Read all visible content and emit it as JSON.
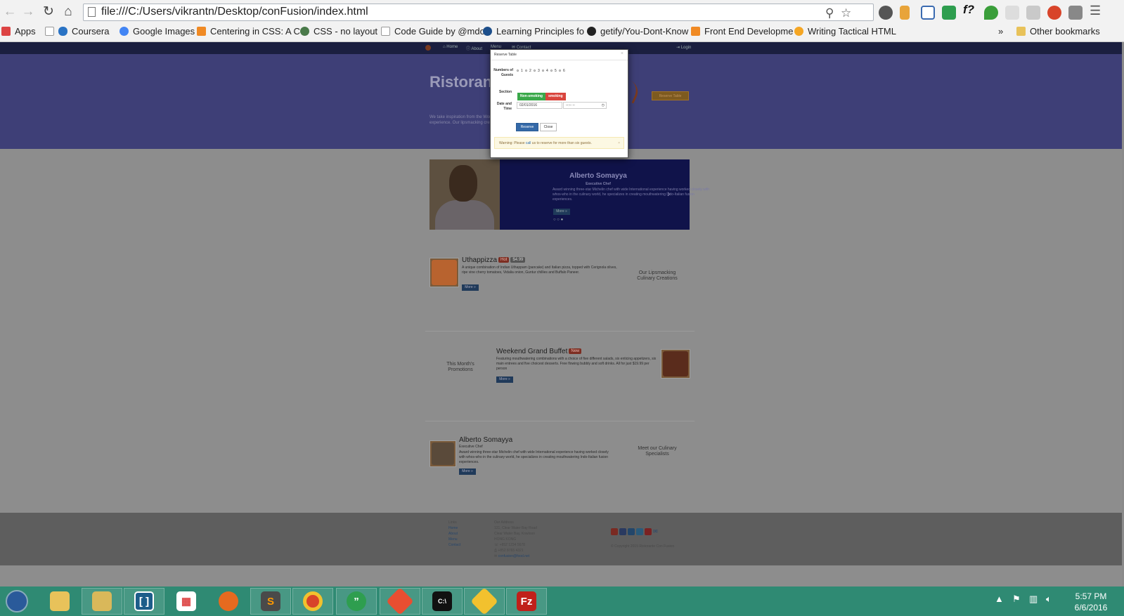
{
  "browser": {
    "url": "file:///C:/Users/vikrantn/Desktop/conFusion/index.html",
    "bookmarks": [
      "Apps",
      "Coursera",
      "Google Images",
      "Centering in CSS: A C",
      "CSS - no layout",
      "Code Guide by @mdo",
      "Learning Principles fo",
      "getify/You-Dont-Know",
      "Front End Developme",
      "Writing Tactical HTML"
    ],
    "bookmarks_overflow": "»",
    "other_bookmarks": "Other bookmarks"
  },
  "site": {
    "nav": [
      "Home",
      "About",
      "Menu",
      "Contact"
    ],
    "login": "Login",
    "brand_title": "Ristorante",
    "jumbo_text_1": "We take inspiration from the World's best cuisines, and create a unique fusion",
    "jumbo_text_2": "experience. Our lipsmacking creations will tickle your culinary senses!",
    "reserve_top": "Reserve Table",
    "carousel": {
      "name": "Alberto Somayya",
      "designation": "Executive Chef",
      "description": "Award winning three-star Michelin chef with wide International experience having worked closely with whos-who in the culinary world, he specializes in creating mouthwatering Indo-Italian fusion experiences.",
      "more": "More »",
      "dots": "○ ○ ●",
      "next": "›"
    },
    "dish": {
      "name": "Uthappizza",
      "label": "Hot",
      "price": "$4.99",
      "description": "A unique combination of Indian Uthappam (pancake) and Italian pizza, topped with Cerignola olives, ripe vine cherry tomatoes, Vidalia onion, Guntur chillies and Buffalo Paneer.",
      "more": "More »",
      "side": "Our Lipsmacking Culinary Creations"
    },
    "promo": {
      "name": "Weekend Grand Buffet",
      "label": "New",
      "description": "Featuring mouthwatering combinations with a choice of five different salads, six enticing appetizers, six main entrees and five choicest desserts. Free flowing bubbly and soft drinks. All for just $19.99 per person",
      "more": "More »",
      "side": "This Month's Promotions"
    },
    "leader": {
      "name": "Alberto Somayya",
      "designation": "Executive Chef",
      "description": "Award winning three-star Michelin chef with wide International experience having worked closely with whos-who in the culinary world, he specializes in creating mouthwatering Indo-Italian fusion experiences.",
      "more": "More »",
      "side": "Meet our Culinary Specialists"
    },
    "footer": {
      "links_title": "Links",
      "links": [
        "Home",
        "About",
        "Menu",
        "Contact"
      ],
      "address_title": "Our Address",
      "address_lines": [
        "121, Clear Water Bay Road",
        "Clear Water Bay, Kowloon",
        "HONG KONG",
        "+852 1234 5678",
        "+852 8765 4321",
        "confusion@food.net"
      ],
      "copyright": "© Copyright 2015 Ristorante Con Fusion"
    }
  },
  "modal": {
    "title": "Reserve Table",
    "close": "×",
    "guests_label": "Numbers of Guests",
    "guest_options": [
      "1",
      "2",
      "3",
      "4",
      "5",
      "6"
    ],
    "section_label": "Section",
    "section_nonsmoking": "Non-smoking",
    "section_smoking": "smoking",
    "datetime_label": "Date and Time",
    "date_value": "02/01/2016",
    "time_value": "--:-- --",
    "reserve_button": "Reserve",
    "close_button": "Close",
    "warning_pre": "Warning: Please",
    "warning_link": "call",
    "warning_post": "us to reserve for more than six guests.",
    "warning_close": "×"
  },
  "taskbar": {
    "time": "5:57 PM",
    "date": "6/6/2016"
  },
  "colors": {
    "page_bg": "#8d8d8d",
    "jumbotron": "#3e3f77",
    "nonsmoking": "#3aa84a",
    "smoking": "#d9453d",
    "primary": "#3469a8",
    "taskbar": "#2f8a73"
  }
}
